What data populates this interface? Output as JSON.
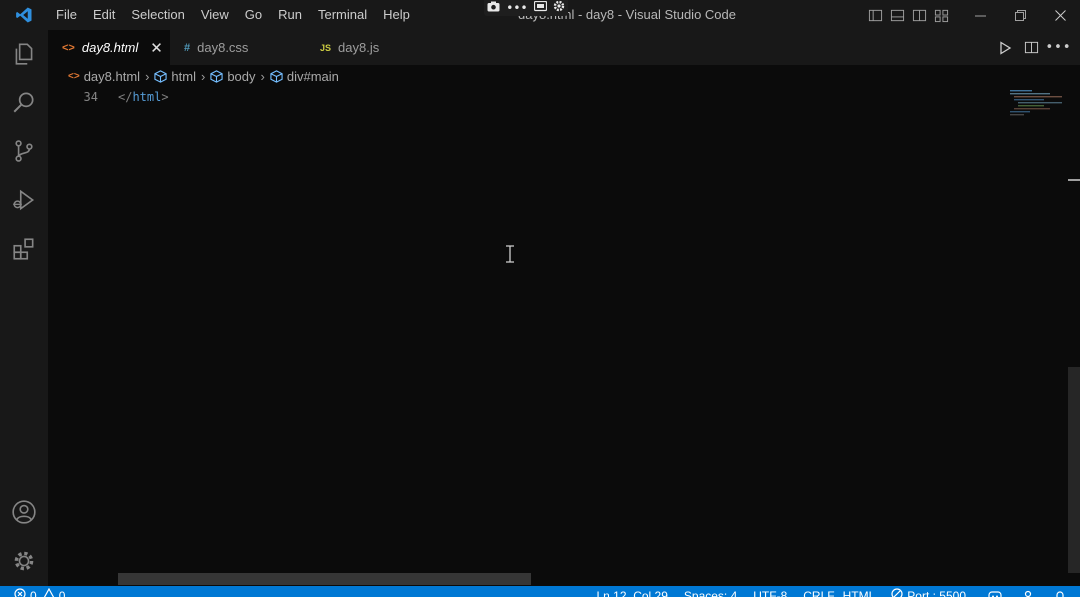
{
  "window": {
    "title": "day8.html - day8 - Visual Studio Code"
  },
  "menu": [
    "File",
    "Edit",
    "Selection",
    "View",
    "Go",
    "Run",
    "Terminal",
    "Help"
  ],
  "tabs": [
    {
      "label": "day8.html",
      "icon": "<>",
      "icon_color": "#e37933",
      "active": true
    },
    {
      "label": "day8.css",
      "icon": "#",
      "icon_color": "#519aba",
      "active": false
    },
    {
      "label": "day8.js",
      "icon": "JS",
      "icon_color": "#cbcb41",
      "active": false
    }
  ],
  "breadcrumb": [
    "day8.html",
    "html",
    "body",
    "div#main"
  ],
  "editor": {
    "line_number": "34",
    "code": {
      "open": "</",
      "tag": "html",
      "close": ">"
    }
  },
  "statusbar": {
    "errors": "0",
    "warnings": "0",
    "position": "Ln 12, Col 29",
    "spaces": "Spaces: 4",
    "encoding": "UTF-8",
    "eol": "CRLF",
    "language": "HTML",
    "port": "Port : 5500"
  },
  "colors": {
    "accent": "#0078d4",
    "editor_bg": "#0b0b0b",
    "chrome_bg": "#181818"
  }
}
